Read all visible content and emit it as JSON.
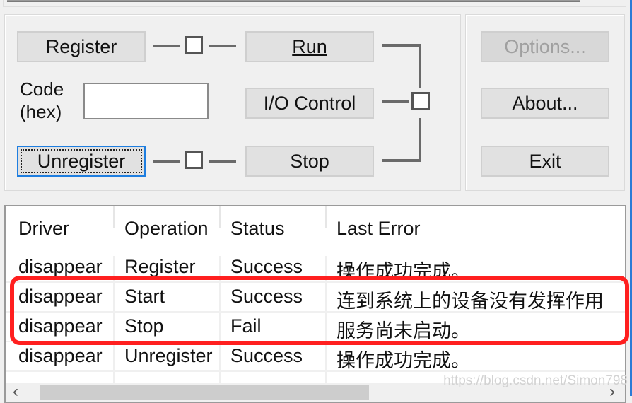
{
  "controls": {
    "register": "Register",
    "unregister": "Unregister",
    "run": "Run",
    "io_control": "I/O Control",
    "stop": "Stop",
    "options": "Options...",
    "about": "About...",
    "exit": "Exit",
    "code_label_line1": "Code",
    "code_label_line2": "(hex)",
    "code_value": ""
  },
  "list": {
    "columns": [
      "Driver",
      "Operation",
      "Status",
      "Last Error"
    ],
    "rows": [
      {
        "driver": "disappear",
        "operation": "Register",
        "status": "Success",
        "last_error": "操作成功完成。"
      },
      {
        "driver": "disappear",
        "operation": "Start",
        "status": "Success",
        "last_error": "连到系统上的设备没有发挥作用"
      },
      {
        "driver": "disappear",
        "operation": "Stop",
        "status": "Fail",
        "last_error": "服务尚未启动。"
      },
      {
        "driver": "disappear",
        "operation": "Unregister",
        "status": "Success",
        "last_error": "操作成功完成。"
      }
    ]
  },
  "annotation": {
    "highlight_color": "#ff1f1f",
    "highlighted_rows": [
      1,
      2
    ]
  },
  "accent_color": "#1e7ee0",
  "watermark": "https://blog.csdn.net/Simon798"
}
